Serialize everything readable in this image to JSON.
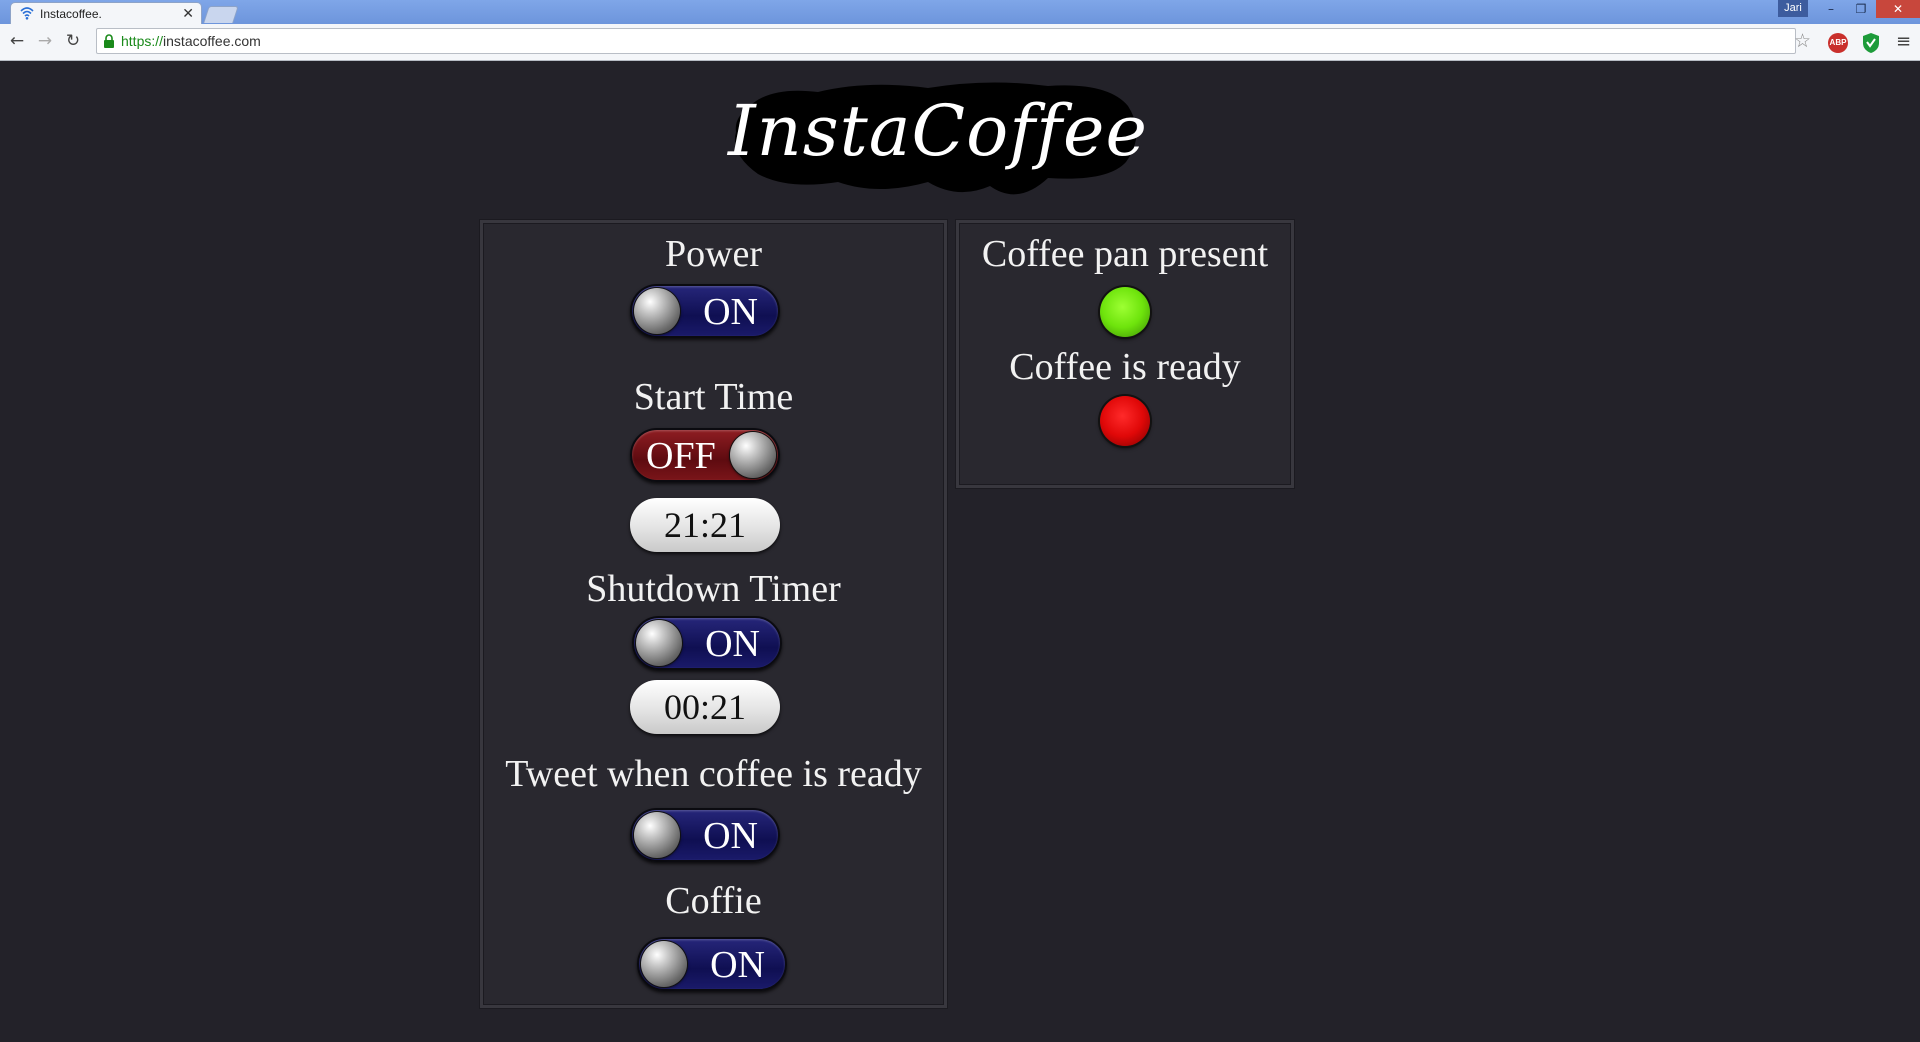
{
  "browser": {
    "tab_title": "Instacoffee.",
    "tab_close": "✕",
    "profile_name": "Jari",
    "url_scheme": "https://",
    "url_host": "instacoffee.com",
    "abp_label": "ABP",
    "window_controls": {
      "minimize": "–",
      "restore": "❐",
      "close": "✕"
    },
    "nav": {
      "back": "←",
      "forward": "→",
      "reload": "↻"
    },
    "star_glyph": "☆",
    "menu_glyph": "≡"
  },
  "logo": {
    "text": "InstaCoffee"
  },
  "controls": {
    "power": {
      "label": "Power",
      "state": "ON"
    },
    "start_time": {
      "label": "Start Time",
      "state": "OFF",
      "time": "21:21"
    },
    "shutdown_timer": {
      "label": "Shutdown Timer",
      "state": "ON",
      "time": "00:21"
    },
    "tweet": {
      "label": "Tweet when coffee is ready",
      "state": "ON"
    },
    "coffie": {
      "label": "Coffie",
      "state": "ON"
    }
  },
  "status": {
    "pan_present": {
      "label": "Coffee pan present",
      "indicator_color": "#6ee40c"
    },
    "coffee_ready": {
      "label": "Coffee is ready",
      "indicator_color": "#e00808"
    }
  },
  "colors": {
    "page_background": "#232229",
    "toggle_on": "#12125a",
    "toggle_off": "#6e1015"
  }
}
